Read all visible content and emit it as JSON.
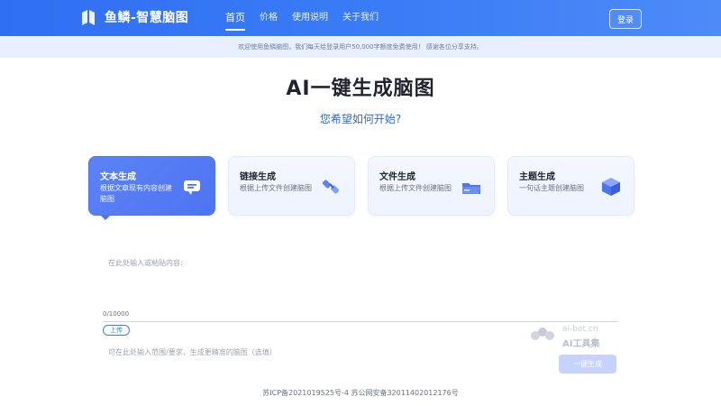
{
  "header": {
    "brand": "鱼鳞-智慧脑图",
    "nav": [
      "首页",
      "价格",
      "使用说明",
      "关于我们"
    ],
    "login": "登录"
  },
  "notice": "欢迎使用鱼鳞脑图，我们每天给登录用户50,000字额度免费使用！ 感谢各位分享支持。",
  "hero": {
    "title": "AI一键生成脑图",
    "subtitle": "您希望如何开始?"
  },
  "cards": [
    {
      "title": "文本生成",
      "desc": "根据文章现有内容创建脑图"
    },
    {
      "title": "链接生成",
      "desc": "根据上传文件创建脑图"
    },
    {
      "title": "文件生成",
      "desc": "根据上传文件创建脑图"
    },
    {
      "title": "主题生成",
      "desc": "一句话主题创建脑图"
    }
  ],
  "editor": {
    "placeholder": "在此处输入或粘贴内容:",
    "counter": "0/10000",
    "upload": "上传",
    "hint": "可在此处输入范围/要求，生成更精准的脑图（选填）",
    "generate": "一键生成"
  },
  "watermark": {
    "line1": "ai-bot.cn",
    "line2": "AI工具集"
  },
  "footer": "苏ICP备2021019525号-4  苏公网安备32011402012176号",
  "colors": {
    "accent": "#3b7cf6",
    "notice_bg": "#e8efff",
    "card_active": "#4e74f0"
  }
}
